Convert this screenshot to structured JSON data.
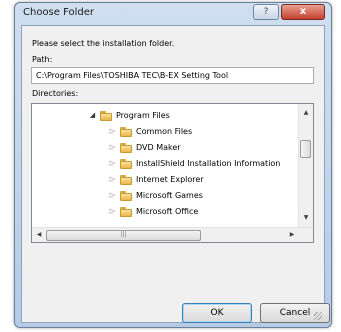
{
  "window": {
    "title": "Choose Folder",
    "help_label": "?",
    "close_label": "x"
  },
  "dialog": {
    "instruction": "Please select the installation folder.",
    "path_label": "Path:",
    "path_value": "C:\\Program Files\\TOSHIBA TEC\\B-EX Setting Tool",
    "directories_label": "Directories:"
  },
  "tree": {
    "root": "Program Files",
    "items": [
      {
        "label": "Common Files"
      },
      {
        "label": "DVD Maker"
      },
      {
        "label": "InstallShield Installation Information"
      },
      {
        "label": "Internet Explorer"
      },
      {
        "label": "Microsoft Games"
      },
      {
        "label": "Microsoft Office"
      }
    ]
  },
  "buttons": {
    "ok": "OK",
    "cancel": "Cancel"
  },
  "icons": {
    "folder": "folder-icon",
    "expanded": "triangle-down-icon",
    "collapsed": "triangle-right-icon",
    "scroll_up": "arrow-up-icon",
    "scroll_down": "arrow-down-icon",
    "scroll_left": "arrow-left-icon",
    "scroll_right": "arrow-right-icon"
  }
}
